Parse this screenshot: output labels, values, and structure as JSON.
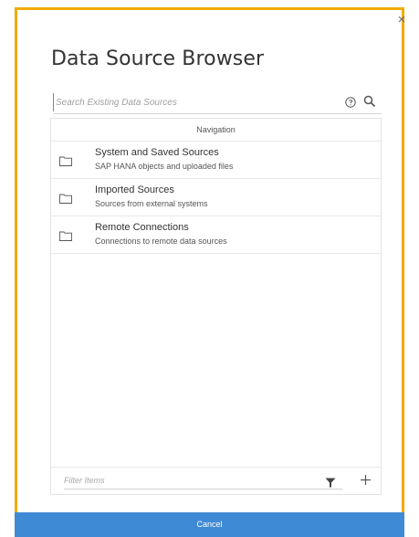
{
  "dialog": {
    "title": "Data Source Browser",
    "close_glyph": "×"
  },
  "search": {
    "placeholder": "Search Existing Data Sources",
    "value": ""
  },
  "navigation": {
    "header": "Navigation",
    "items": [
      {
        "title": "System and Saved Sources",
        "subtitle": "SAP HANA objects and uploaded files",
        "icon": "folder-icon"
      },
      {
        "title": "Imported Sources",
        "subtitle": "Sources from external systems",
        "icon": "folder-icon"
      },
      {
        "title": "Remote Connections",
        "subtitle": "Connections to remote data sources",
        "icon": "folder-icon"
      }
    ]
  },
  "filter": {
    "placeholder": "Filter Items",
    "value": ""
  },
  "footer": {
    "cancel_label": "Cancel"
  },
  "colors": {
    "accent_border": "#f0ab00",
    "footer_bg": "#3f8ad4"
  },
  "icons": [
    "close-icon",
    "help-icon",
    "search-icon",
    "folder-icon",
    "filter-icon",
    "add-icon"
  ]
}
